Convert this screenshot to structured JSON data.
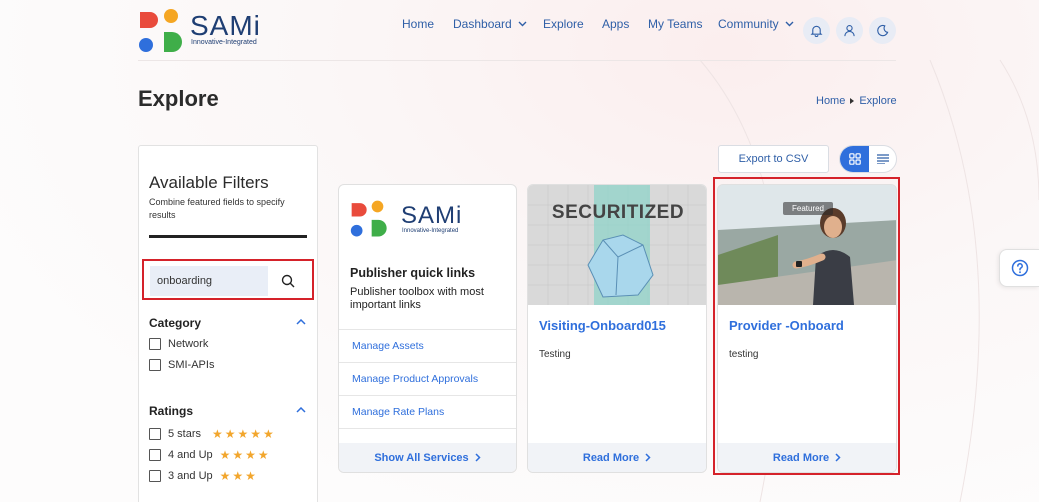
{
  "brand": {
    "name": "SAMi",
    "tagline": "Innovative-Integrated"
  },
  "nav": {
    "items": [
      {
        "label": "Home"
      },
      {
        "label": "Dashboard"
      },
      {
        "label": "Explore"
      },
      {
        "label": "Apps"
      },
      {
        "label": "My Teams"
      },
      {
        "label": "Community"
      }
    ],
    "icons": [
      "bell-icon",
      "user-icon",
      "moon-icon"
    ]
  },
  "page": {
    "title": "Explore"
  },
  "breadcrumb": {
    "home": "Home",
    "current": "Explore"
  },
  "filters": {
    "title": "Available Filters",
    "subtitle": "Combine featured fields to specify results",
    "search_value": "onboarding",
    "category": {
      "title": "Category",
      "options": [
        "Network",
        "SMI-APIs"
      ]
    },
    "ratings": {
      "title": "Ratings",
      "options": [
        {
          "label": "5 stars",
          "stars": "★★★★★"
        },
        {
          "label": "4 and Up",
          "stars": "★★★★"
        },
        {
          "label": "3 and Up",
          "stars": "★★★"
        }
      ]
    }
  },
  "toolbar": {
    "export_label": "Export to CSV"
  },
  "quick_links": {
    "title": "Publisher quick links",
    "subtitle": "Publisher toolbox with most important links",
    "links": [
      "Manage Assets",
      "Manage Product Approvals",
      "Manage Rate Plans"
    ],
    "footer": "Show All Services"
  },
  "cards": [
    {
      "image_text": "SECURITIZED",
      "title": "Visiting-Onboard015",
      "description": "Testing",
      "footer": "Read More"
    },
    {
      "badge": "Featured",
      "title": "Provider -Onboard",
      "description": "testing",
      "footer": "Read More"
    }
  ],
  "colors": {
    "accent": "#2f6fdc",
    "nav_text": "#2f5fa7",
    "brand_navy": "#1f3e73",
    "highlight_red": "#d5222a",
    "star": "#f2a62d"
  }
}
